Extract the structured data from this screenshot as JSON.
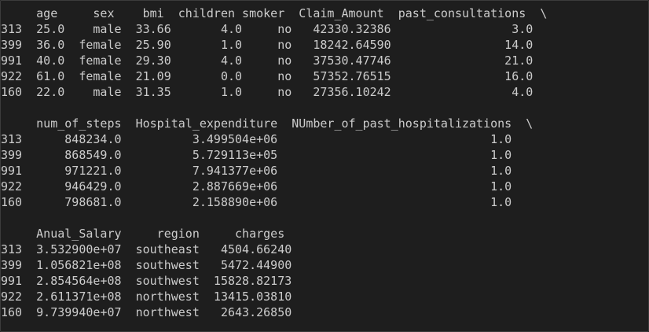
{
  "output": {
    "lines": [
      "     age     sex    bmi  children smoker  Claim_Amount  past_consultations  \\",
      "313  25.0    male  33.66       4.0     no   42330.32386                 3.0",
      "399  36.0  female  25.90       1.0     no   18242.64590                14.0",
      "991  40.0  female  29.30       4.0     no   37530.47746                21.0",
      "922  61.0  female  21.09       0.0     no   57352.76515                16.0",
      "160  22.0    male  31.35       1.0     no   27356.10242                 4.0",
      "",
      "     num_of_steps  Hospital_expenditure  NUmber_of_past_hospitalizations  \\",
      "313      848234.0          3.499504e+06                              1.0",
      "399      868549.0          5.729113e+05                              1.0",
      "991      971221.0          7.941377e+06                              1.0",
      "922      946429.0          2.887669e+06                              1.0",
      "160      798681.0          2.158890e+06                              1.0",
      "",
      "     Anual_Salary     region     charges",
      "313  3.532900e+07  southeast   4504.66240",
      "399  1.056821e+08  southwest   5472.44900",
      "991  2.854564e+08  southwest  15828.82173",
      "922  2.611371e+08  northwest  13415.03810",
      "160  9.739940e+07  northwest   2643.26850"
    ]
  }
}
